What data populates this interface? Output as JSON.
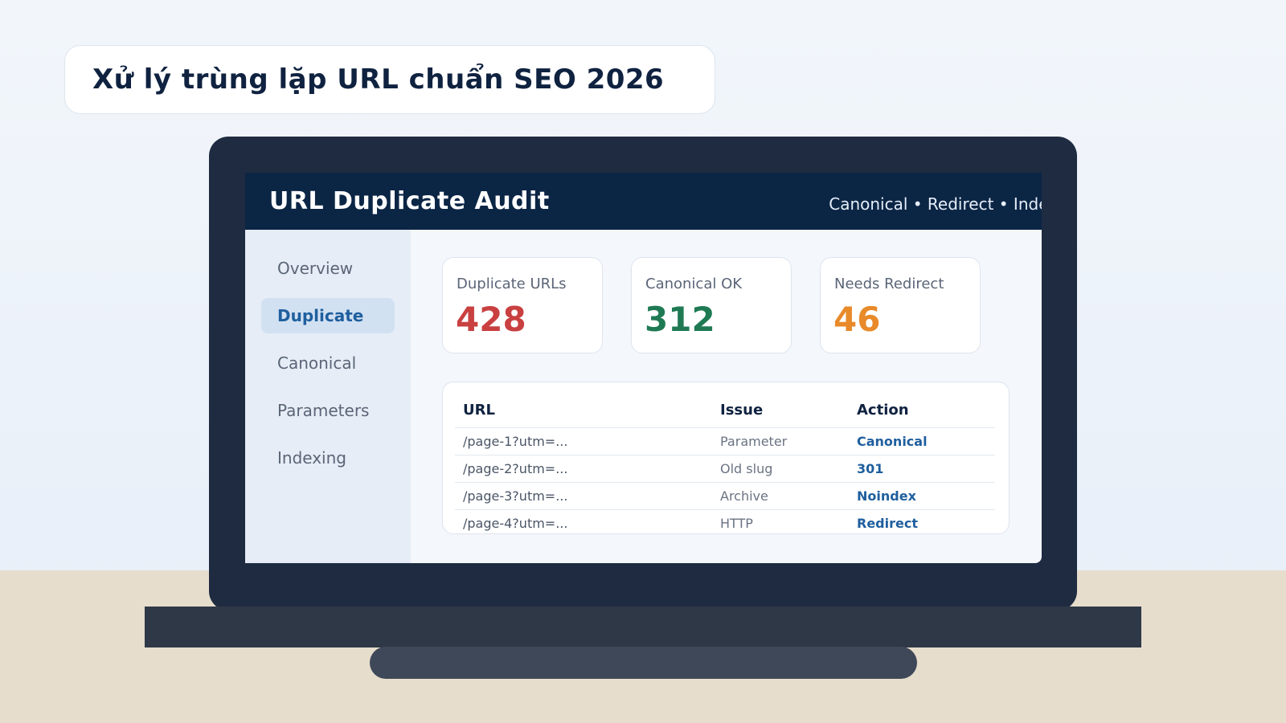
{
  "banner": {
    "title": "Xử lý trùng lặp URL chuẩn SEO 2026"
  },
  "app": {
    "title": "URL Duplicate Audit",
    "tags": "Canonical • Redirect • Index"
  },
  "sidebar": {
    "items": [
      {
        "label": "Overview",
        "active": false
      },
      {
        "label": "Duplicate",
        "active": true
      },
      {
        "label": "Canonical",
        "active": false
      },
      {
        "label": "Parameters",
        "active": false
      },
      {
        "label": "Indexing",
        "active": false
      }
    ]
  },
  "stats": [
    {
      "label": "Duplicate URLs",
      "value": "428",
      "color": "#c94040"
    },
    {
      "label": "Canonical OK",
      "value": "312",
      "color": "#1f7a54"
    },
    {
      "label": "Needs Redirect",
      "value": "46",
      "color": "#e88a2a"
    }
  ],
  "table": {
    "headers": [
      "URL",
      "Issue",
      "Action"
    ],
    "rows": [
      {
        "url": "/page-1?utm=...",
        "issue": "Parameter",
        "action": "Canonical"
      },
      {
        "url": "/page-2?utm=...",
        "issue": "Old slug",
        "action": "301"
      },
      {
        "url": "/page-3?utm=...",
        "issue": "Archive",
        "action": "Noindex"
      },
      {
        "url": "/page-4?utm=...",
        "issue": "HTTP",
        "action": "Redirect"
      }
    ]
  },
  "colors": {
    "topbar": "#0b2545",
    "accent": "#1f5f9e",
    "bezel": "#1e2b41"
  }
}
